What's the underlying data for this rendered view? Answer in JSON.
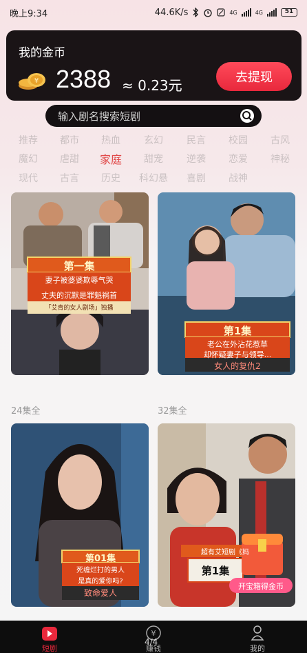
{
  "status": {
    "time": "晚上9:34",
    "speed": "44.6K/s",
    "net1": "4G",
    "net2": "4G",
    "battery": "51"
  },
  "coins": {
    "title": "我的金币",
    "amount": "2388",
    "approx": "≈ 0.23元",
    "withdraw": "去提现"
  },
  "search": {
    "placeholder": "输入剧名搜索短剧"
  },
  "categories": [
    [
      "推荐",
      "都市",
      "热血",
      "玄幻",
      "民言",
      "校园",
      "古风"
    ],
    [
      "魔幻",
      "虐甜",
      "家庭",
      "甜宠",
      "逆袭",
      "恋爱",
      "神秘"
    ],
    [
      "现代",
      "古言",
      "历史",
      "科幻悬",
      "喜剧",
      "战神"
    ]
  ],
  "active_category": "家庭",
  "cards": [
    {
      "caption1": "第一集",
      "caption2": "妻子被婆婆欺辱气哭",
      "caption3": "丈夫的沉默是罪魁祸首",
      "caption4": "「艾青的女人剧场」独播"
    },
    {
      "caption1": "第1集",
      "caption2": "老公在外沾花惹草",
      "caption3": "却怀疑妻子与领导...",
      "caption4": "女人的复仇2"
    },
    {
      "caption1": "第01集",
      "caption2": "死缠烂打的男人",
      "caption3": "是真的爱你吗?",
      "caption4": "致命爱人"
    },
    {
      "caption1": "第1集",
      "caption2": "超有艾短剧《妈",
      "chest": "开宝箱得金币"
    }
  ],
  "episodes": [
    "24集全",
    "32集全"
  ],
  "tabs": {
    "short": "短剧",
    "earn": "赚钱",
    "mine": "我的",
    "page": "4/4"
  },
  "colors": {
    "accent": "#e8283c",
    "dark": "#1a1416"
  }
}
